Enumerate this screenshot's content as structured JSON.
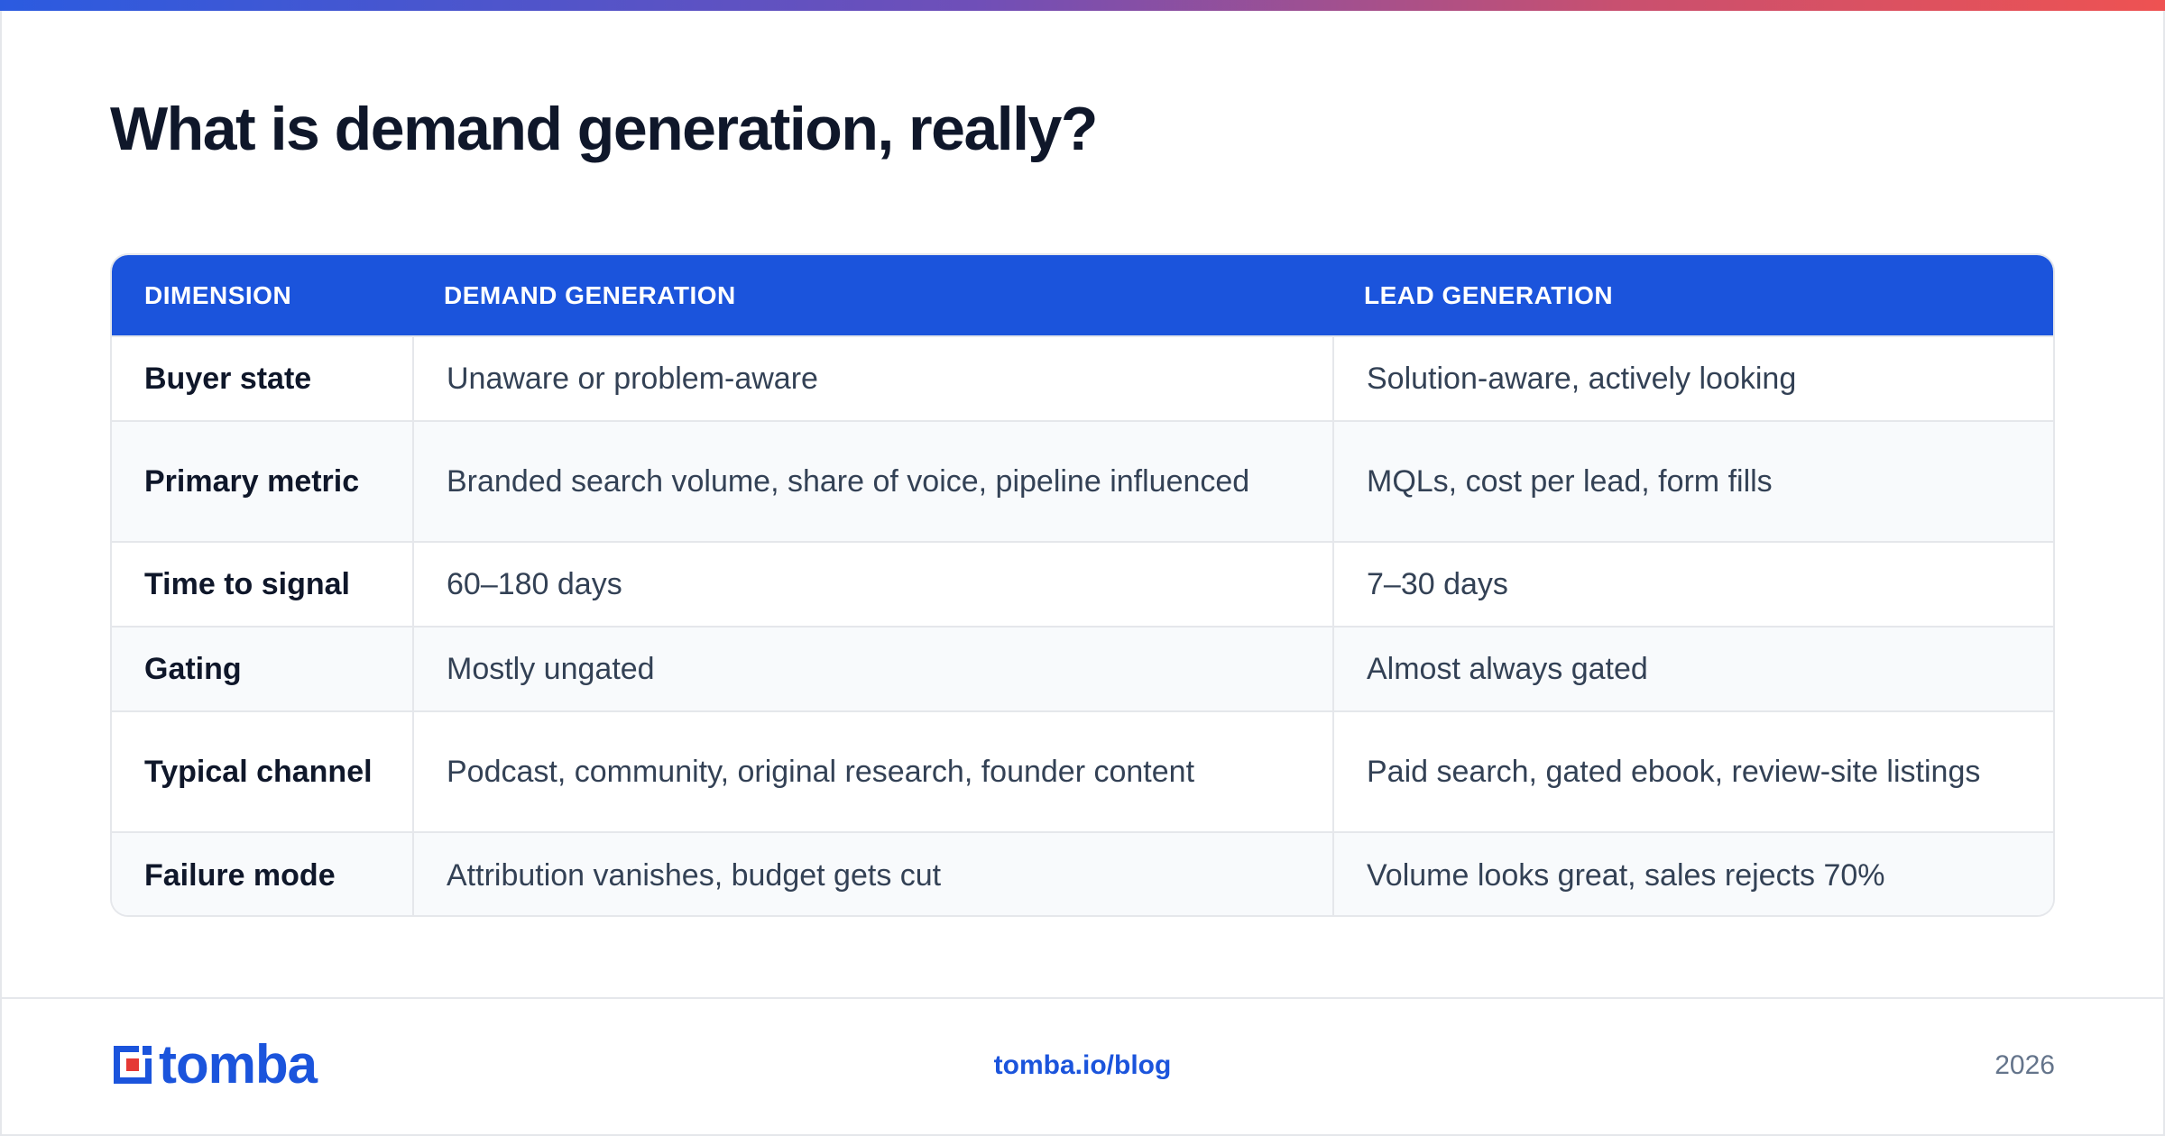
{
  "title": "What is demand generation, really?",
  "colors": {
    "accent": "#1b54dc",
    "logo_red": "#e53935",
    "gradient_start": "#2b5be0",
    "gradient_end": "#ee5252"
  },
  "table": {
    "headers": [
      "DIMENSION",
      "DEMAND GENERATION",
      "LEAD GENERATION"
    ],
    "rows": [
      {
        "dimension": "Buyer state",
        "demand": "Unaware or problem-aware",
        "lead": "Solution-aware, actively looking"
      },
      {
        "dimension": "Primary metric",
        "demand": "Branded search volume, share of voice, pipeline influenced",
        "lead": "MQLs, cost per lead, form fills"
      },
      {
        "dimension": "Time to signal",
        "demand": "60–180 days",
        "lead": "7–30 days"
      },
      {
        "dimension": "Gating",
        "demand": "Mostly ungated",
        "lead": "Almost always gated"
      },
      {
        "dimension": "Typical channel",
        "demand": "Podcast, community, original research, founder content",
        "lead": "Paid search, gated ebook, review-site listings"
      },
      {
        "dimension": "Failure mode",
        "demand": "Attribution vanishes, budget gets cut",
        "lead": "Volume looks great, sales rejects 70%"
      }
    ]
  },
  "footer": {
    "logo_text": "tomba",
    "link": "tomba.io/blog",
    "year": "2026"
  }
}
